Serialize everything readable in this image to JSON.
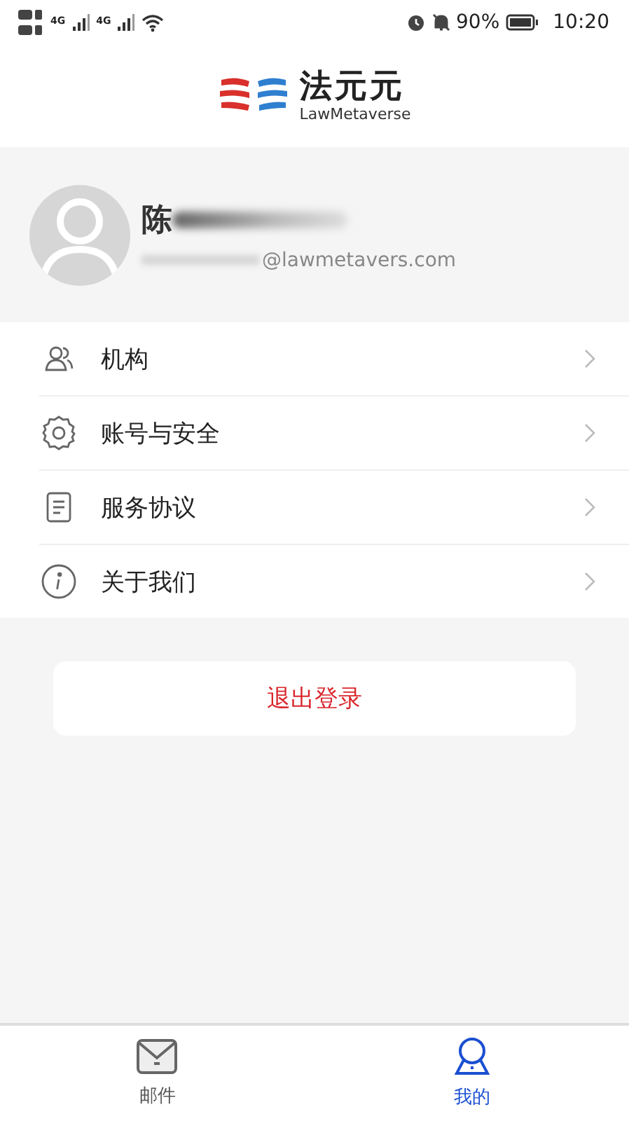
{
  "status_bar": {
    "network_1": "4G",
    "network_2": "4G",
    "battery": "90%",
    "time": "10:20"
  },
  "header": {
    "logo_title": "法元元",
    "logo_subtitle": "LawMetaverse"
  },
  "profile": {
    "name": "陈",
    "email": "@lawmetavers.com"
  },
  "menu": [
    {
      "kind": "people",
      "label": "机构"
    },
    {
      "kind": "gear",
      "label": "账号与安全"
    },
    {
      "kind": "document",
      "label": "服务协议"
    },
    {
      "kind": "info",
      "label": "关于我们"
    }
  ],
  "logout_button": "退出登录",
  "tabs": [
    {
      "kind": "mail",
      "label": "邮件",
      "selected": false
    },
    {
      "kind": "person",
      "label": "我的",
      "selected": true
    }
  ]
}
